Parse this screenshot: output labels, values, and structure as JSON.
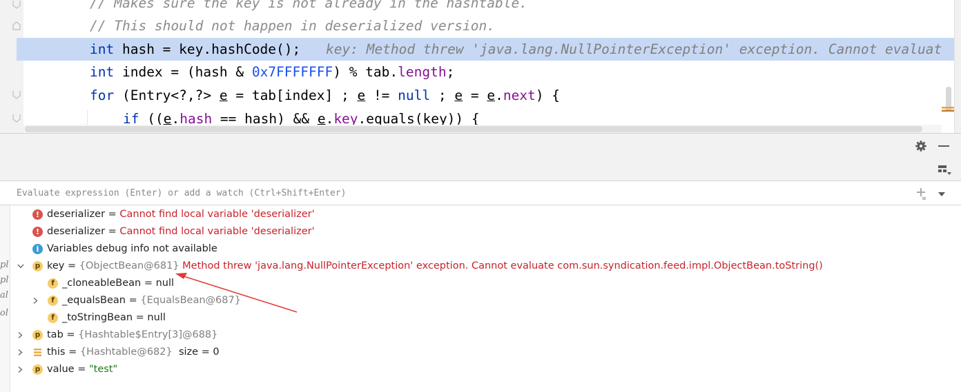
{
  "editor": {
    "lines": [
      {
        "text": "// Makes sure the key is not already in the hashtable."
      },
      {
        "text": "// This should not happen in deserialized version."
      },
      {
        "kw": "int",
        "rest": " hash = key.hashCode();",
        "inlay": "key: Method threw 'java.lang.NullPointerException' exception. Cannot evaluat"
      },
      {
        "kw": "int",
        "a": " index = (hash & ",
        "num": "0x7FFFFFFF",
        "b": ") % tab.",
        "fld": "length",
        "c": ";"
      },
      {
        "kw": "for",
        "a": " (Entry<?,?> ",
        "e1": "e",
        "b": " = tab[index] ; ",
        "e2": "e",
        "c": " != ",
        "kw2": "null",
        "d": " ; ",
        "e3": "e",
        "f": " = ",
        "e4": "e",
        "g": ".",
        "fld": "next",
        "h": ") {"
      },
      {
        "kw": "if",
        "a": " ((",
        "e1": "e",
        "b": ".",
        "fld1": "hash",
        "c": " == hash) && ",
        "e2": "e",
        "d": ".",
        "fld2": "key",
        "f": ".equals(key)) {"
      }
    ]
  },
  "debugger": {
    "eval_placeholder": "Evaluate expression (Enter) or add a watch (Ctrl+Shift+Enter)",
    "icons": {
      "settings": "gear-icon",
      "minimize": "minimize-icon",
      "layout": "layout-icon",
      "add_watch": "add-watch-icon",
      "dropdown": "chevron-down-icon"
    },
    "left_strip_marks": [
      "pl",
      "pl",
      "al.",
      "ol"
    ]
  },
  "variables": [
    {
      "icon": "error-icon",
      "name": "deserializer",
      "eq": " = ",
      "value": "Cannot find local variable 'deserializer'"
    },
    {
      "icon": "error-icon",
      "name": "deserializer",
      "eq": " = ",
      "value": "Cannot find local variable 'deserializer'"
    },
    {
      "icon": "info-icon",
      "message": "Variables debug info not available"
    },
    {
      "icon": "p",
      "name": "key",
      "eq": " = ",
      "ref": "{ObjectBean@681}",
      "error": "Method threw 'java.lang.NullPointerException' exception. Cannot evaluate com.sun.syndication.feed.impl.ObjectBean.toString()",
      "expanded": true
    },
    {
      "icon": "f",
      "name": "_cloneableBean",
      "eq": " = ",
      "value": "null"
    },
    {
      "icon": "f",
      "name": "_equalsBean",
      "eq": " = ",
      "ref": "{EqualsBean@687}",
      "collapsed": true
    },
    {
      "icon": "f",
      "name": "_toStringBean",
      "eq": " = ",
      "value": "null"
    },
    {
      "icon": "p",
      "name": "tab",
      "eq": " = ",
      "ref": "{Hashtable$Entry[3]@688}",
      "collapsed": true
    },
    {
      "icon": "stack-icon",
      "name": "this",
      "eq": " = ",
      "ref": "{Hashtable@682}",
      "extra": "  size = 0",
      "collapsed": true
    },
    {
      "icon": "p",
      "name": "value",
      "eq": " = ",
      "str": "\"test\"",
      "collapsed": true
    }
  ],
  "colors": {
    "accent_highlight": "#c6d8f4",
    "error": "#c7222a",
    "keyword": "#0033b3",
    "field": "#871094",
    "annotation_arrow": "#e53935"
  },
  "badges": {
    "p": "p",
    "f": "f",
    "err": "!",
    "info": "i"
  }
}
